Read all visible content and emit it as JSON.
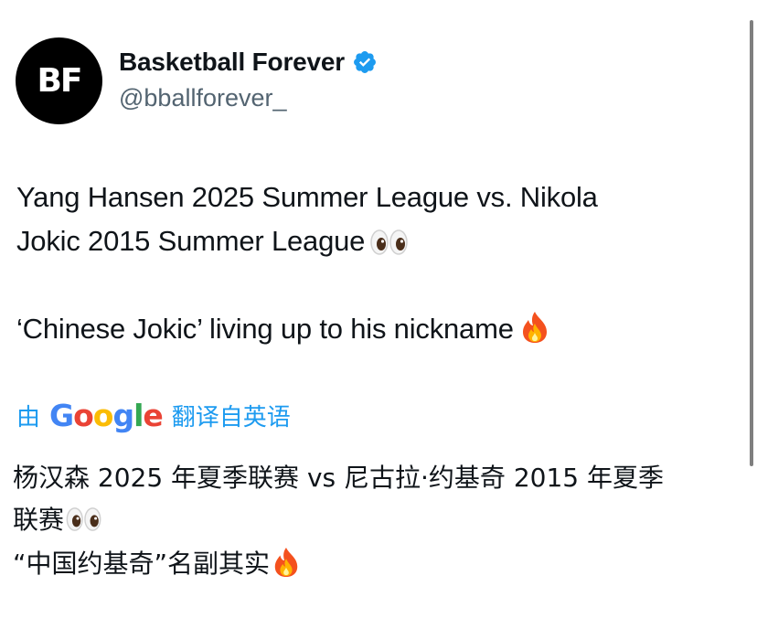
{
  "author": {
    "avatar_text": "BF",
    "display_name": "Basketball Forever",
    "handle": "@bballforever_"
  },
  "tweet": {
    "line1": "Yang Hansen 2025 Summer League vs. Nikola",
    "line2": "Jokic 2015 Summer League",
    "line3": "‘Chinese Jokic’ living up to his nickname"
  },
  "translation": {
    "prefix": "由",
    "provider": "Google",
    "suffix": "翻译自英语",
    "line1": "杨汉森 2025 年夏季联赛 vs 尼古拉·约基奇 2015 年夏季",
    "line2": "联赛",
    "line3": "“中国约基奇”名副其实"
  },
  "icons": {
    "verified": "verified-badge-icon",
    "eyes": "eyes-emoji-icon",
    "fire": "fire-emoji-icon"
  },
  "colors": {
    "accent": "#1d9bf0",
    "text": "#0f1419",
    "secondary_text": "#536471"
  }
}
